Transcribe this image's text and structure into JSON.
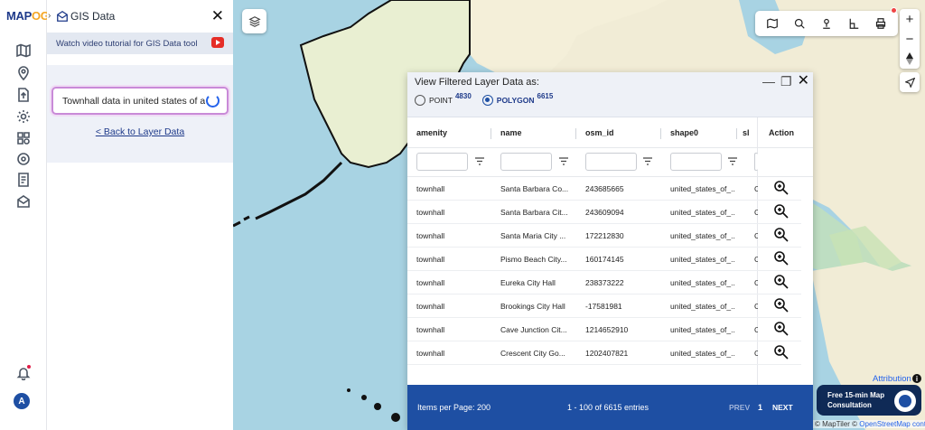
{
  "app": {
    "logo_main": "MAP",
    "logo_accent": "OG"
  },
  "panel": {
    "title": "GIS Data",
    "tutorial_text": "Watch video tutorial for GIS Data tool",
    "search_value": "Townhall data in united states of am",
    "back_link": "< Back to Layer Data"
  },
  "dialog": {
    "title": "View Filtered Layer Data as:",
    "options": [
      {
        "label": "POINT",
        "count": "4830",
        "selected": false
      },
      {
        "label": "POLYGON",
        "count": "6615",
        "selected": true
      }
    ],
    "columns": [
      "amenity",
      "name",
      "osm_id",
      "shape0",
      "sl",
      "Action"
    ],
    "rows": [
      [
        "townhall",
        "Santa Barbara Co...",
        "243685665",
        "united_states_of_...",
        "C"
      ],
      [
        "townhall",
        "Santa Barbara Cit...",
        "243609094",
        "united_states_of_...",
        "C"
      ],
      [
        "townhall",
        "Santa Maria City ...",
        "172212830",
        "united_states_of_...",
        "C"
      ],
      [
        "townhall",
        "Pismo Beach City...",
        "160174145",
        "united_states_of_...",
        "C"
      ],
      [
        "townhall",
        "Eureka City Hall",
        "238373222",
        "united_states_of_...",
        "C"
      ],
      [
        "townhall",
        "Brookings City Hall",
        "-17581981",
        "united_states_of_...",
        "C"
      ],
      [
        "townhall",
        "Cave Junction Cit...",
        "1214652910",
        "united_states_of_...",
        "C"
      ],
      [
        "townhall",
        "Crescent City Go...",
        "1202407821",
        "united_states_of_...",
        "C"
      ]
    ],
    "footer": {
      "items_per_page": "Items per Page: 200",
      "range": "1 - 100 of 6615 entries",
      "prev": "PREV",
      "page": "1",
      "next": "NEXT"
    }
  },
  "map": {
    "attribution": "Attribution",
    "credit_prefix": "© MapTiler © ",
    "credit_link": "OpenStreetMap contributors",
    "consult_line1": "Free 15-min Map",
    "consult_line2": "Consultation",
    "zoom_in": "+",
    "zoom_out": "−"
  },
  "avatar": {
    "initial": "A"
  },
  "colors": {
    "accent": "#1e4fa3",
    "water": "#a8d3e3",
    "land": "#f1ecd6",
    "forest": "#c8e2b4"
  }
}
